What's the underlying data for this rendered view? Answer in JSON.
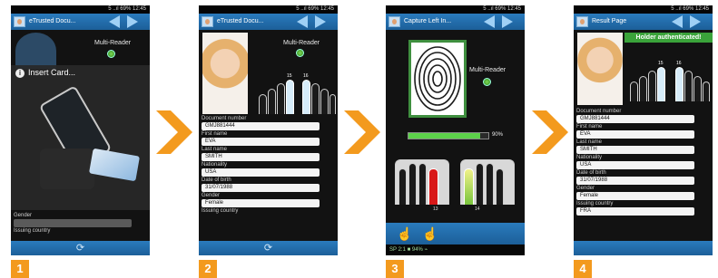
{
  "status": {
    "text": "5 ..ıl 69% 12:45"
  },
  "screens": [
    {
      "step": "1",
      "title": "eTrusted Docu...",
      "reader_label": "Multi-Reader",
      "dialog_title": "Insert Card...",
      "fields": [
        {
          "label": "Gender",
          "value": ""
        },
        {
          "label": "Issuing country",
          "value": ""
        }
      ]
    },
    {
      "step": "2",
      "title": "eTrusted Docu...",
      "reader_label": "Multi-Reader",
      "finger_left": "15",
      "finger_right": "16",
      "fields": [
        {
          "label": "Document number",
          "value": "GMJ881444"
        },
        {
          "label": "First name",
          "value": "EVA"
        },
        {
          "label": "Last name",
          "value": "SMITH"
        },
        {
          "label": "Nationality",
          "value": "USA"
        },
        {
          "label": "Date of birth",
          "value": "31/07/1988"
        },
        {
          "label": "Gender",
          "value": "Female"
        },
        {
          "label": "Issuing country",
          "value": ""
        }
      ]
    },
    {
      "step": "3",
      "title": "Capture Left In...",
      "reader_label": "Multi-Reader",
      "progress_text": "90%",
      "progress_value": 0.9,
      "finger_left": "13",
      "finger_right": "14",
      "bottom_status": "SP 2:1 ■ 94% ⌁"
    },
    {
      "step": "4",
      "title": "Result Page",
      "banner": "Holder authenticated!",
      "finger_left": "15",
      "finger_right": "16",
      "fields": [
        {
          "label": "Document number",
          "value": "GMJ881444"
        },
        {
          "label": "First name",
          "value": "EVA"
        },
        {
          "label": "Last name",
          "value": "SMITH"
        },
        {
          "label": "Nationality",
          "value": "USA"
        },
        {
          "label": "Date of birth",
          "value": "31/07/1988"
        },
        {
          "label": "Gender",
          "value": "Female"
        },
        {
          "label": "Issuing country",
          "value": "FRA"
        }
      ]
    }
  ],
  "colors": {
    "accent": "#f39a1e",
    "titlebar": "#2a7bbd",
    "green_banner": "#3aa33a"
  }
}
